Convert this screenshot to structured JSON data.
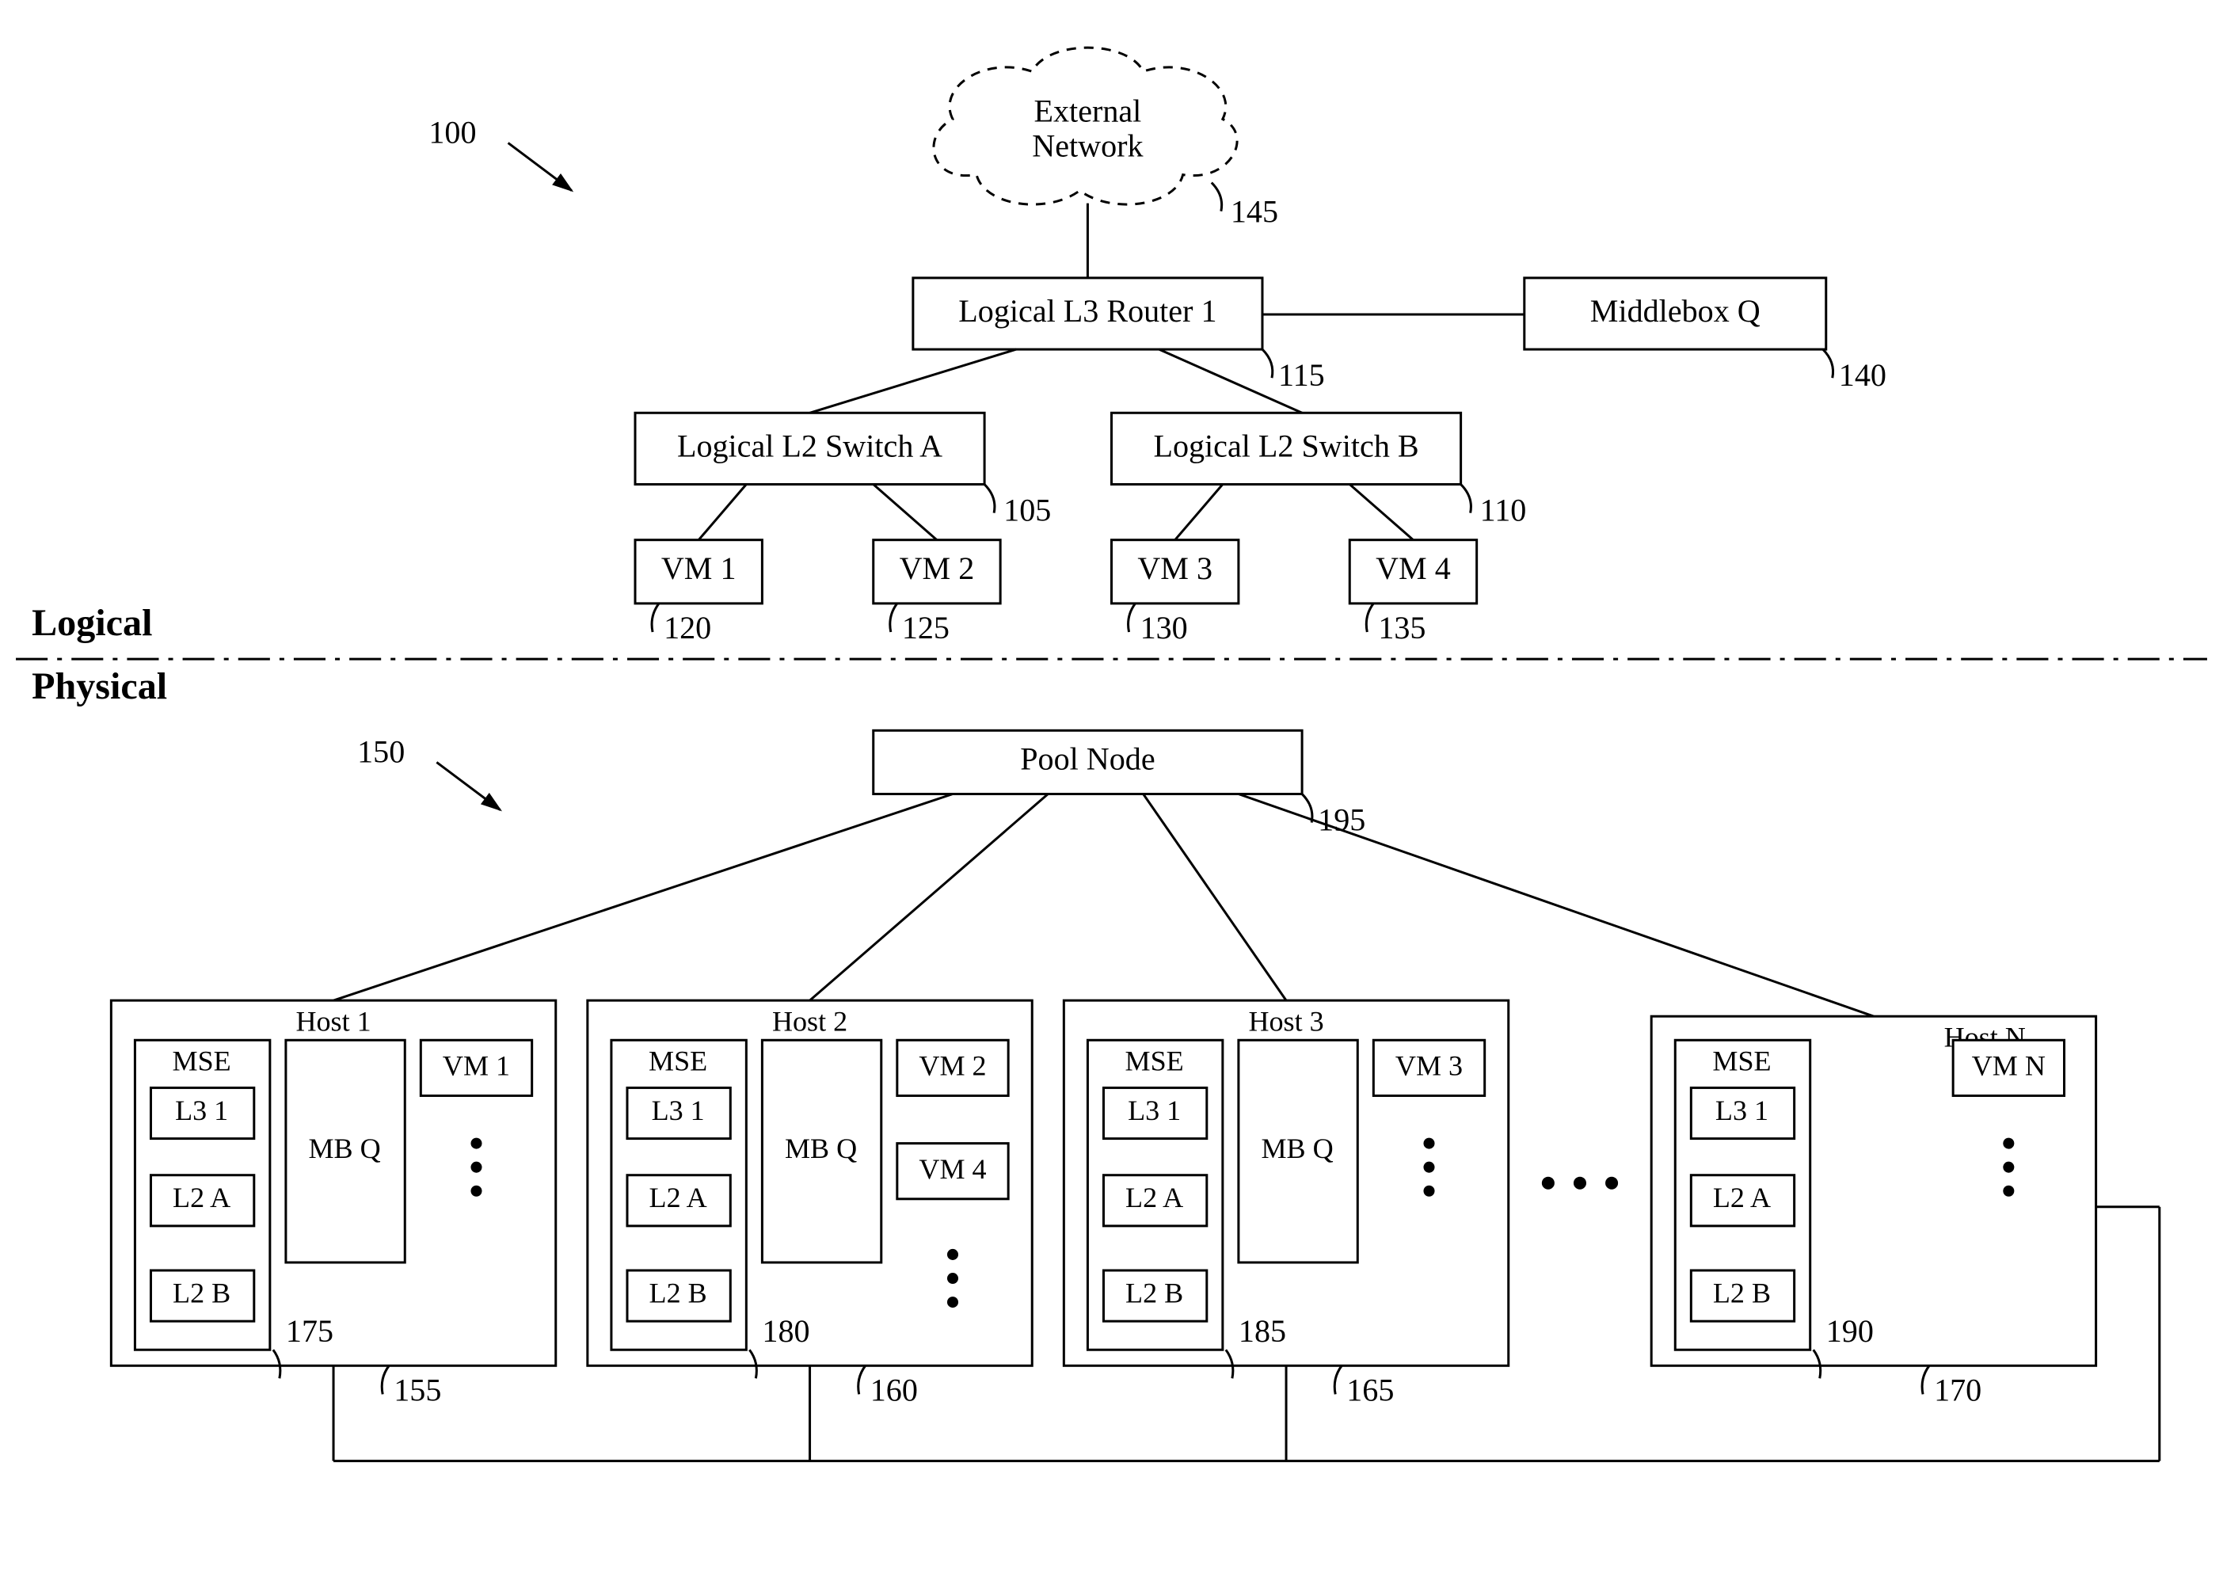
{
  "sections": {
    "logical": "Logical",
    "physical": "Physical"
  },
  "refs": {
    "r100": "100",
    "r145": "145",
    "r115": "115",
    "r140": "140",
    "r105": "105",
    "r110": "110",
    "r120": "120",
    "r125": "125",
    "r130": "130",
    "r135": "135",
    "r150": "150",
    "r195": "195",
    "r155": "155",
    "r160": "160",
    "r165": "165",
    "r170": "170",
    "r175": "175",
    "r180": "180",
    "r185": "185",
    "r190": "190"
  },
  "logical": {
    "external": {
      "l1": "External",
      "l2": "Network"
    },
    "router": "Logical L3 Router 1",
    "middlebox": "Middlebox Q",
    "switchA": "Logical L2 Switch A",
    "switchB": "Logical L2 Switch B",
    "vm1": "VM 1",
    "vm2": "VM 2",
    "vm3": "VM 3",
    "vm4": "VM 4"
  },
  "physical": {
    "pool": "Pool Node",
    "hosts": {
      "h1": {
        "title": "Host 1",
        "mse": "MSE",
        "l3": "L3 1",
        "l2a": "L2 A",
        "l2b": "L2 B",
        "mb": "MB Q",
        "vmA": "VM 1"
      },
      "h2": {
        "title": "Host 2",
        "mse": "MSE",
        "l3": "L3 1",
        "l2a": "L2 A",
        "l2b": "L2 B",
        "mb": "MB Q",
        "vmA": "VM 2",
        "vmB": "VM 4"
      },
      "h3": {
        "title": "Host 3",
        "mse": "MSE",
        "l3": "L3 1",
        "l2a": "L2 A",
        "l2b": "L2 B",
        "mb": "MB Q",
        "vmA": "VM 3"
      },
      "hN": {
        "title": "Host N",
        "mse": "MSE",
        "l3": "L3 1",
        "l2a": "L2 A",
        "l2b": "L2 B",
        "vmA": "VM N"
      }
    }
  }
}
